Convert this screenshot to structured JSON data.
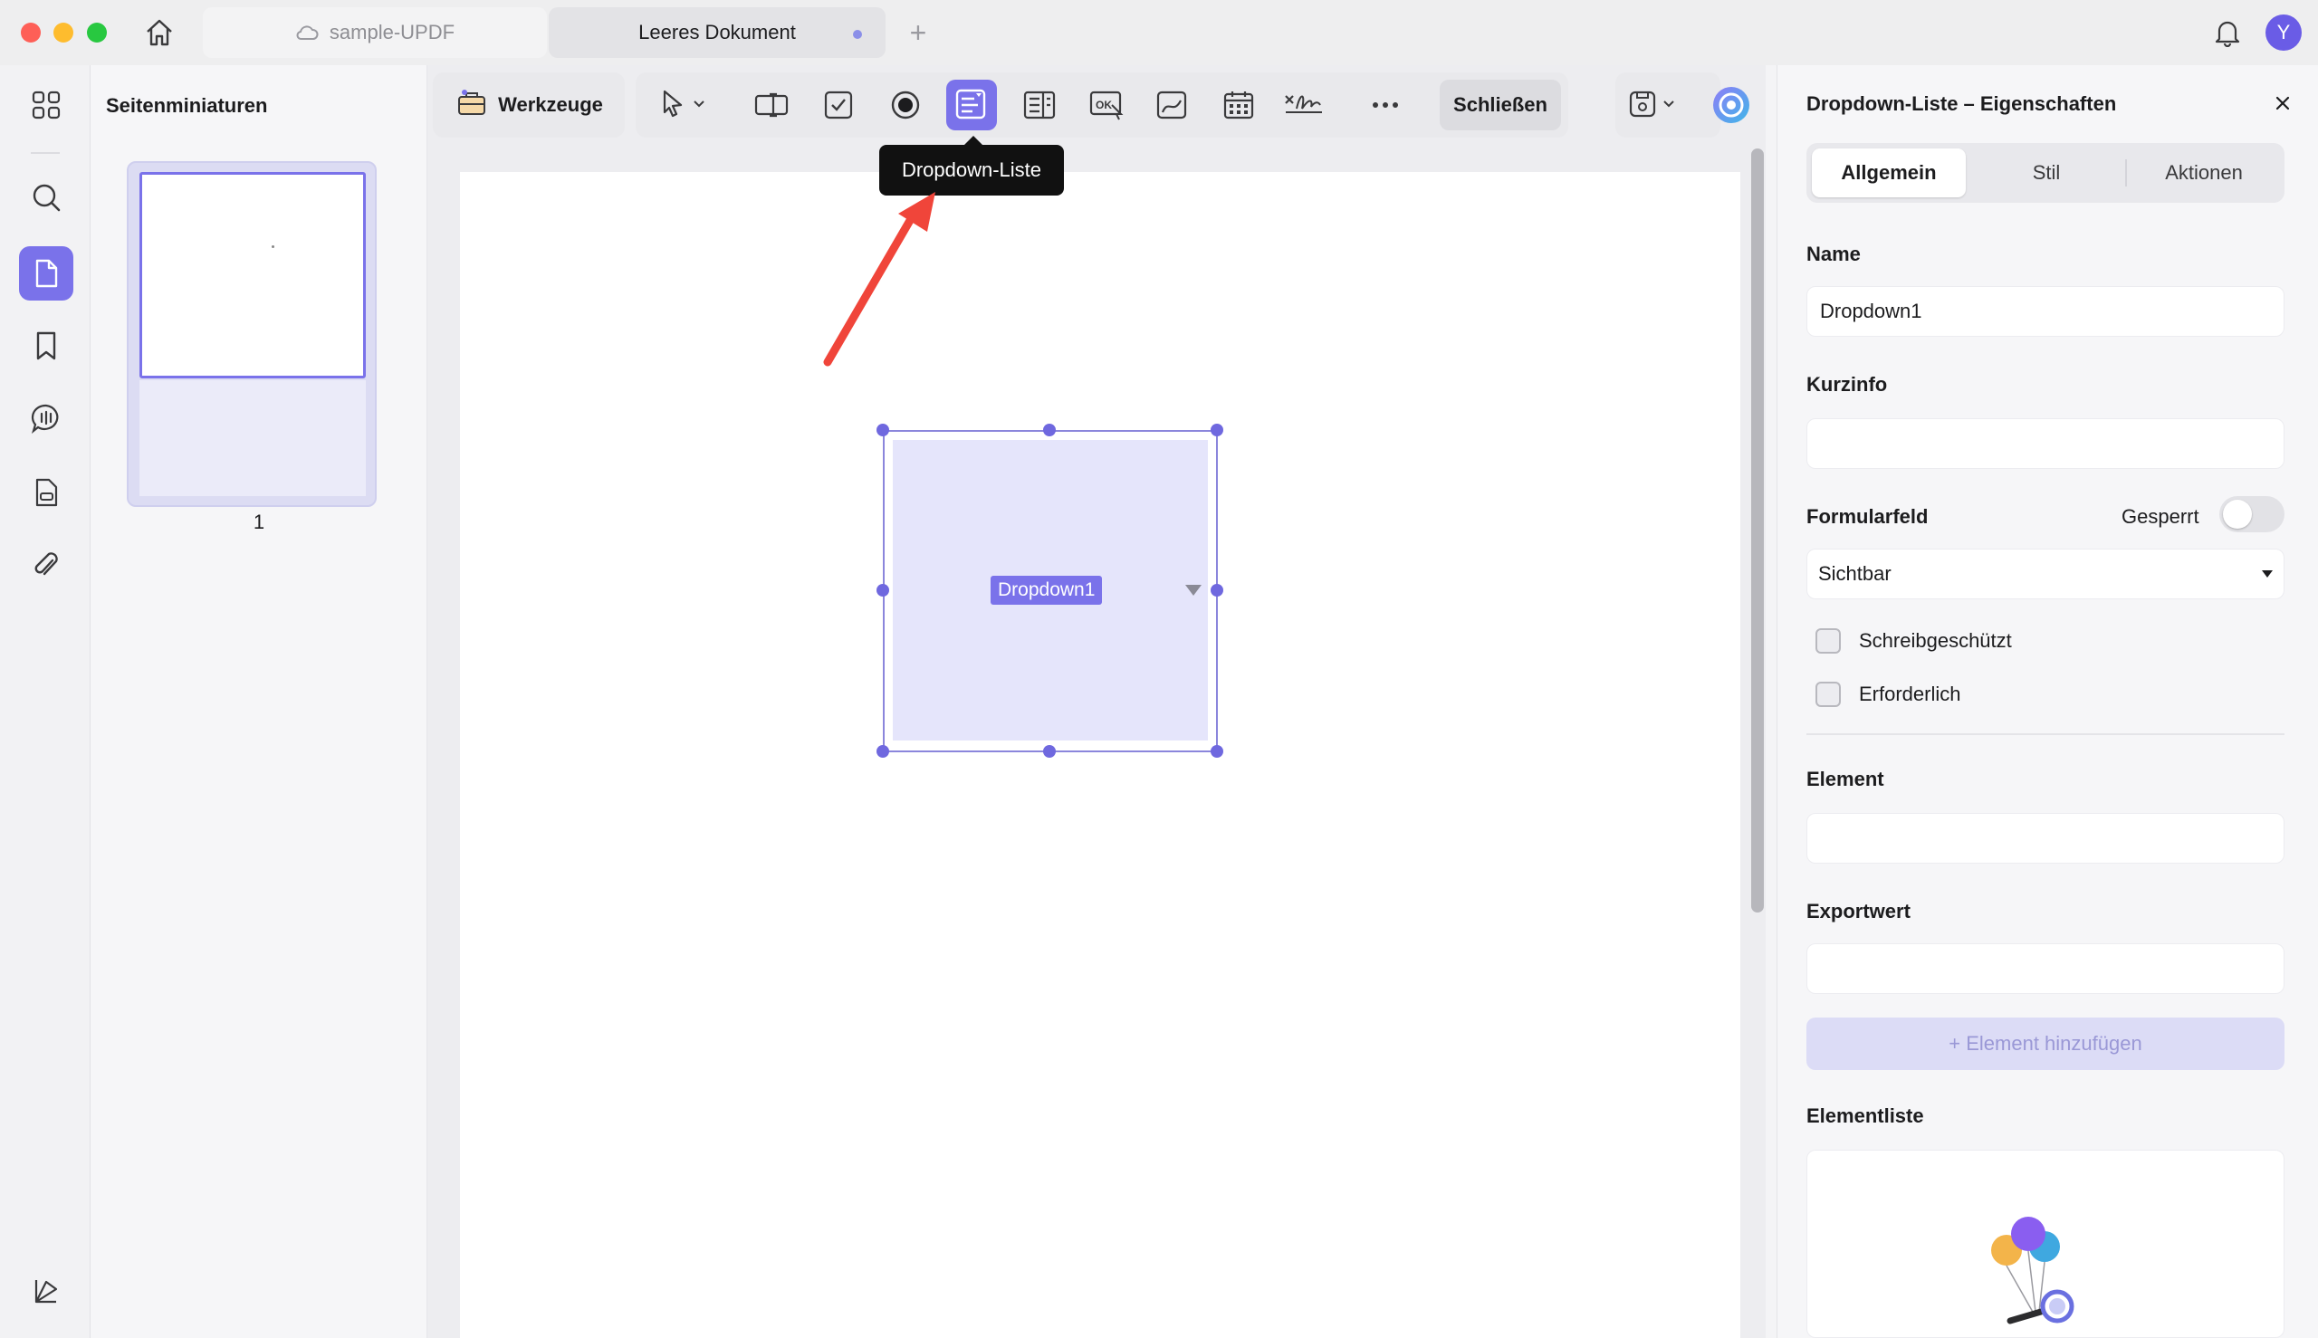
{
  "titlebar": {
    "tabs": [
      {
        "label": "sample-UPDF"
      },
      {
        "label": "Leeres Dokument"
      }
    ],
    "new_tab": "+",
    "avatar_initial": "Y"
  },
  "thumbnails": {
    "title": "Seitenminiaturen",
    "pages": [
      {
        "number": "1"
      }
    ]
  },
  "toolbar": {
    "tools_label": "Werkzeuge",
    "close_label": "Schließen",
    "tooltip": "Dropdown-Liste"
  },
  "document": {
    "field_name": "Dropdown1"
  },
  "properties": {
    "title": "Dropdown-Liste – Eigenschaften",
    "tabs": [
      {
        "label": "Allgemein",
        "active": true
      },
      {
        "label": "Stil",
        "active": false
      },
      {
        "label": "Aktionen",
        "active": false
      }
    ],
    "name_label": "Name",
    "name_value": "Dropdown1",
    "tooltip_label": "Kurzinfo",
    "tooltip_value": "",
    "form_field_label": "Formularfeld",
    "locked_label": "Gesperrt",
    "locked": false,
    "visibility_value": "Sichtbar",
    "checkboxes": [
      {
        "label": "Schreibgeschützt",
        "checked": false
      },
      {
        "label": "Erforderlich",
        "checked": false
      }
    ],
    "element_label": "Element",
    "element_value": "",
    "export_label": "Exportwert",
    "export_value": "",
    "add_button": "+ Element hinzufügen",
    "list_label": "Elementliste"
  },
  "colors": {
    "accent": "#7a72ea",
    "annotation_arrow": "#f0453a"
  },
  "icons": {
    "rail": [
      "grid-icon",
      "search-icon",
      "page-icon",
      "bookmark-icon",
      "comment-icon",
      "form-icon",
      "paperclip-icon",
      "layers-icon"
    ],
    "toolbar": [
      "select-arrow-icon",
      "text-field-icon",
      "checkbox-icon",
      "radio-button-icon",
      "dropdown-list-icon",
      "list-box-icon",
      "ok-button-icon",
      "image-field-icon",
      "date-field-icon",
      "signature-field-icon",
      "more-icon",
      "save-icon",
      "ai-assistant-icon"
    ]
  }
}
